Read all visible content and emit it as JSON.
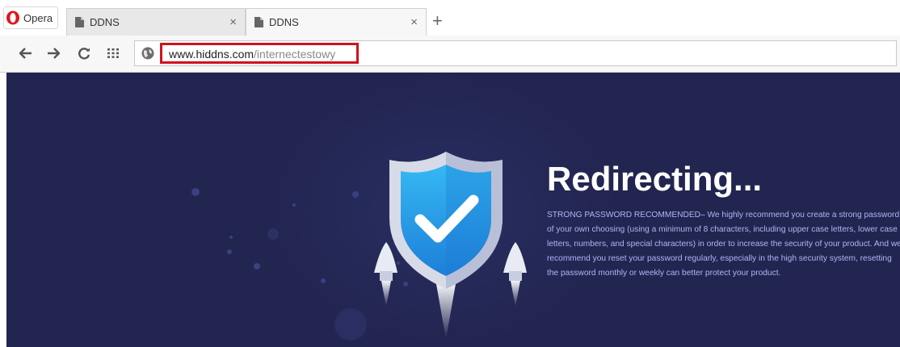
{
  "browser": {
    "menu_label": "Opera",
    "tabs": [
      {
        "title": "DDNS",
        "close": "×",
        "active": false
      },
      {
        "title": "DDNS",
        "close": "×",
        "active": true
      }
    ],
    "new_tab": "+"
  },
  "address_bar": {
    "url_host": "www.hiddns.com",
    "url_path": "/internectestowy",
    "highlight_color": "#d0121f"
  },
  "page": {
    "heading": "Redirecting...",
    "message": "STRONG PASSWORD RECOMMENDED– We highly recommend you create a strong password of your own choosing (using a minimum of 8 characters, including upper case letters, lower case letters, numbers, and special characters) in order to increase the security of your product. And we recommend you reset your password regularly, especially in the high security system, resetting the password monthly or weekly can better protect your product.",
    "background_color": "#22254f",
    "text_color": "#aeb6f4"
  },
  "icons": {
    "opera_logo": "opera-logo-icon",
    "page": "page-icon",
    "back": "back-arrow-icon",
    "forward": "forward-arrow-icon",
    "reload": "reload-icon",
    "speed_dial": "speed-dial-icon",
    "site_info": "globe-icon",
    "shield": "shield-check-icon"
  }
}
